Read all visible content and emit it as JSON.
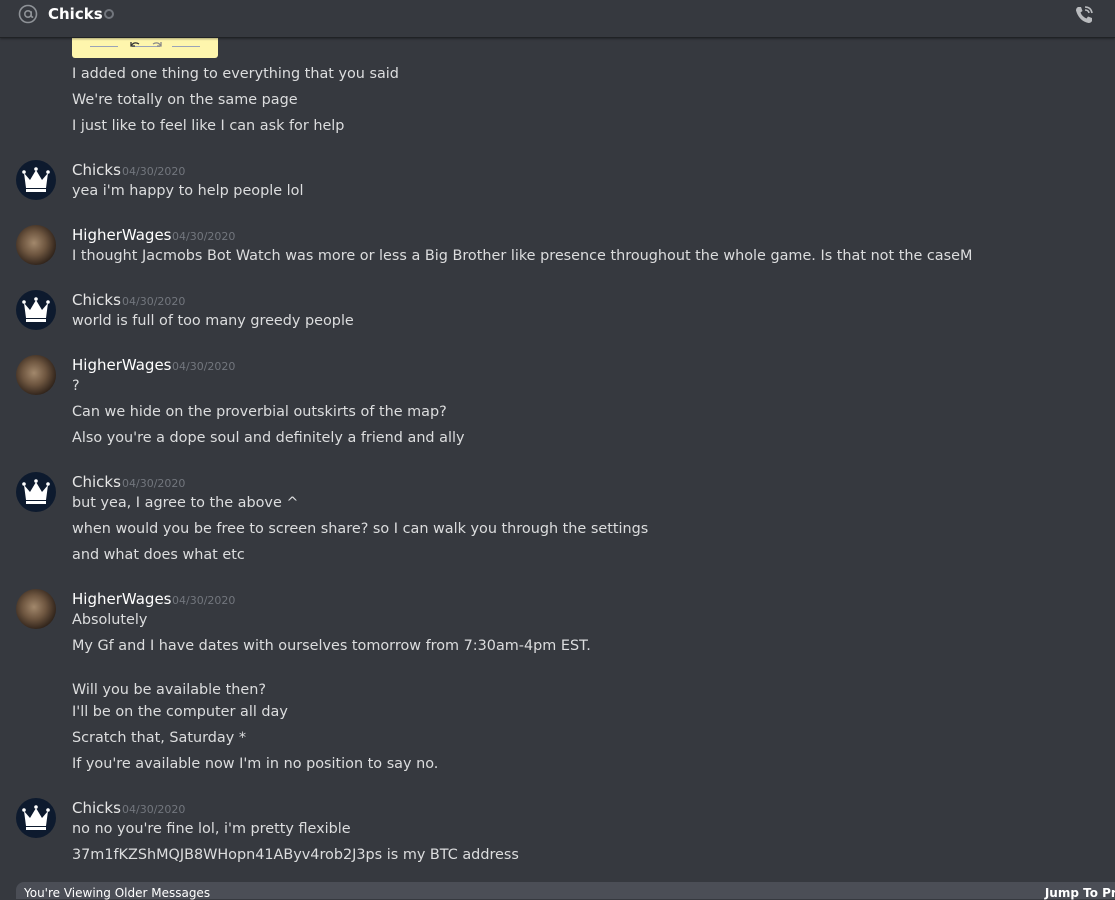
{
  "header": {
    "channel_name": "Chicks",
    "icon_left": "at-icon",
    "icon_right": "phone-icon"
  },
  "attachment": {
    "icon": "undo-redo-icon"
  },
  "groups": [
    {
      "lines": [
        "I added one thing to everything that you said",
        "We're totally on the same page",
        "I just like to feel like I can ask for help"
      ]
    },
    {
      "author": "Chicks",
      "timestamp": "04/30/2020",
      "lines": [
        "yea i'm happy to help people lol"
      ]
    },
    {
      "author": "HigherWages",
      "timestamp": "04/30/2020",
      "lines": [
        "I thought Jacmobs Bot Watch was more or less a Big Brother like presence throughout the whole game. Is that not the caseM"
      ]
    },
    {
      "author": "Chicks",
      "timestamp": "04/30/2020",
      "lines": [
        "world is full of too many greedy people"
      ]
    },
    {
      "author": "HigherWages",
      "timestamp": "04/30/2020",
      "lines": [
        "?",
        "Can we hide on the proverbial outskirts of the map?",
        "Also you're a dope soul and definitely a friend and ally"
      ]
    },
    {
      "author": "Chicks",
      "timestamp": "04/30/2020",
      "lines": [
        "but yea, I agree to the above ^",
        "when would you be free to screen share? so I can walk you through the settings",
        "and what does what etc"
      ]
    },
    {
      "author": "HigherWages",
      "timestamp": "04/30/2020",
      "lines": [
        "Absolutely",
        "My Gf and I have dates with ourselves tomorrow from 7:30am-4pm EST.",
        "Will you be available then?",
        "I'll be on the computer all day",
        "Scratch that, Saturday *",
        "If you're available now I'm in no position to say no."
      ]
    },
    {
      "author": "Chicks",
      "timestamp": "04/30/2020",
      "lines": [
        "no no you're fine lol, i'm pretty flexible",
        "37m1fKZShMQJB8WHopn41AByv4rob2J3ps is my BTC address"
      ]
    }
  ],
  "footer": {
    "notice": "You're Viewing Older Messages",
    "jump": "Jump To Pre"
  }
}
